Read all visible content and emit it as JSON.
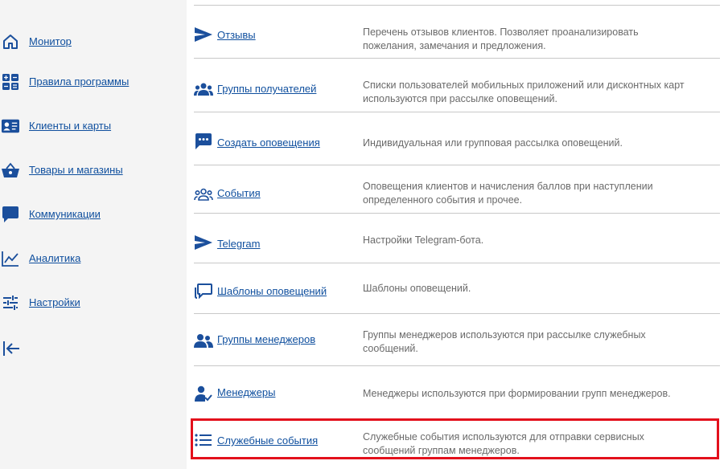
{
  "sidebar": {
    "items": [
      {
        "label": "Монитор",
        "icon": "home-icon"
      },
      {
        "label": "Правила программы",
        "icon": "calculator-icon"
      },
      {
        "label": "Клиенты и карты",
        "icon": "id-card-icon"
      },
      {
        "label": "Товары и магазины",
        "icon": "basket-icon"
      },
      {
        "label": "Коммуникации",
        "icon": "chat-icon"
      },
      {
        "label": "Аналитика",
        "icon": "chart-line-icon"
      },
      {
        "label": "Настройки",
        "icon": "sliders-icon"
      }
    ],
    "collapse_icon": "collapse-arrow-icon"
  },
  "main": {
    "rows": [
      {
        "title": "Отзывы",
        "icon": "send-icon",
        "description": "Перечень отзывов клиентов. Позволяет проанализировать пожелания, замечания и предложения."
      },
      {
        "title": "Группы получателей",
        "icon": "group-icon",
        "description": "Списки пользователей мобильных приложений или дисконтных карт используются при рассылке оповещений."
      },
      {
        "title": "Создать оповещения",
        "icon": "message-dots-icon",
        "description": "Индивидуальная или групповая рассылка оповещений."
      },
      {
        "title": "События",
        "icon": "group-outline-icon",
        "description": "Оповещения клиентов и начисления баллов при наступлении определенного события и прочее."
      },
      {
        "title": "Telegram",
        "icon": "send-icon",
        "description": "Настройки Telegram-бота."
      },
      {
        "title": "Шаблоны оповещений",
        "icon": "message-template-icon",
        "description": "Шаблоны оповещений."
      },
      {
        "title": "Группы менеджеров",
        "icon": "managers-group-icon",
        "description": "Группы менеджеров используются при рассылке служебных сообщений."
      },
      {
        "title": "Менеджеры",
        "icon": "manager-check-icon",
        "description": "Менеджеры используются при формировании групп менеджеров."
      },
      {
        "title": "Служебные события",
        "icon": "list-icon",
        "description": "Служебные события используются для отправки сервисных сообщений группам менеджеров."
      }
    ]
  },
  "colors": {
    "link": "#0f4f9e",
    "icon": "#1b4f9c",
    "highlight": "#e3101c",
    "sidebar_bg": "#f4f4f4"
  }
}
